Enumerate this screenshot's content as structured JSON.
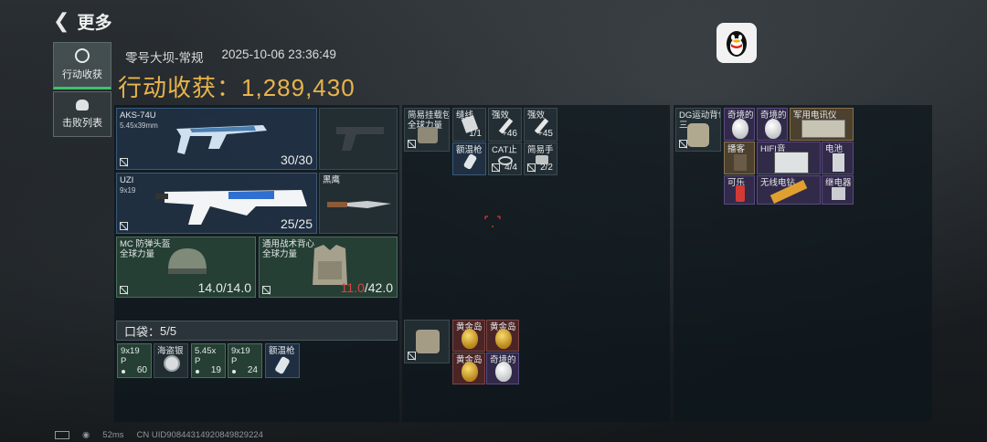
{
  "header": {
    "back_icon": "chevron-left-icon",
    "title": "更多"
  },
  "sidebar": {
    "tabs": [
      {
        "label": "行动收获",
        "icon": "target-icon",
        "active": true
      },
      {
        "label": "击败列表",
        "icon": "skull-icon",
        "active": false
      }
    ]
  },
  "session": {
    "map": "零号大坝-常规",
    "datetime": "2025-10-06 23:36:49"
  },
  "harvest": {
    "label": "行动收获：",
    "value": "1,289,430",
    "color": "#e9b44c"
  },
  "weapons": [
    {
      "name": "AKS-74U",
      "sub": "5.45x39mm",
      "count": "30/30"
    },
    {
      "name": "UZI",
      "sub": "9x19",
      "count": "25/25"
    },
    {
      "name": "黑鹰",
      "sub": ""
    }
  ],
  "armor": [
    {
      "name": "MC 防弹头盔",
      "sub": "全球力量",
      "cur": "14.0",
      "max": "/14.0"
    },
    {
      "name": "通用战术背心",
      "sub": "全球力量",
      "cur": "11.0",
      "max": "/42.0",
      "cur_color": "#e0403a"
    }
  ],
  "pockets": {
    "label": "口袋：",
    "value": "5/5",
    "items": [
      {
        "name": "9x19",
        "sub": "P",
        "count": "60"
      },
      {
        "name": "海盗银",
        "sub": "",
        "count": ""
      },
      {
        "name": "5.45x",
        "sub": "P",
        "count": "19"
      },
      {
        "name": "9x19",
        "sub": "P",
        "count": "24"
      },
      {
        "name": "额温枪",
        "sub": "",
        "count": ""
      }
    ]
  },
  "chest_rig": {
    "name": "简易挂载包",
    "sub": "全球力量",
    "items": [
      {
        "name": "缝线",
        "count": "1/1"
      },
      {
        "name": "强效",
        "count": "+46"
      },
      {
        "name": "强效",
        "count": "+45"
      },
      {
        "name": "额温枪",
        "count": ""
      },
      {
        "name": "CAT止",
        "count": "4/4"
      },
      {
        "name": "简易手",
        "count": "2/2"
      }
    ]
  },
  "pouch": {
    "items": [
      {
        "name": "黄金岛"
      },
      {
        "name": "黄金岛"
      },
      {
        "name": "黄金岛"
      },
      {
        "name": "奇境的"
      }
    ]
  },
  "backpack": {
    "name": "DG运动背包",
    "sub": "三",
    "items": [
      {
        "name": "奇境的"
      },
      {
        "name": "奇境的"
      },
      {
        "name": "军用电讯仪"
      },
      {
        "name": "播客"
      },
      {
        "name": "HIFI音"
      },
      {
        "name": "电池"
      },
      {
        "name": "可乐"
      },
      {
        "name": "无线电钻"
      },
      {
        "name": "继电器"
      }
    ]
  },
  "status_bar": {
    "ping": "52ms",
    "uid": "CN UID9084431492084982922​4"
  },
  "qq_icon": "penguin-icon"
}
